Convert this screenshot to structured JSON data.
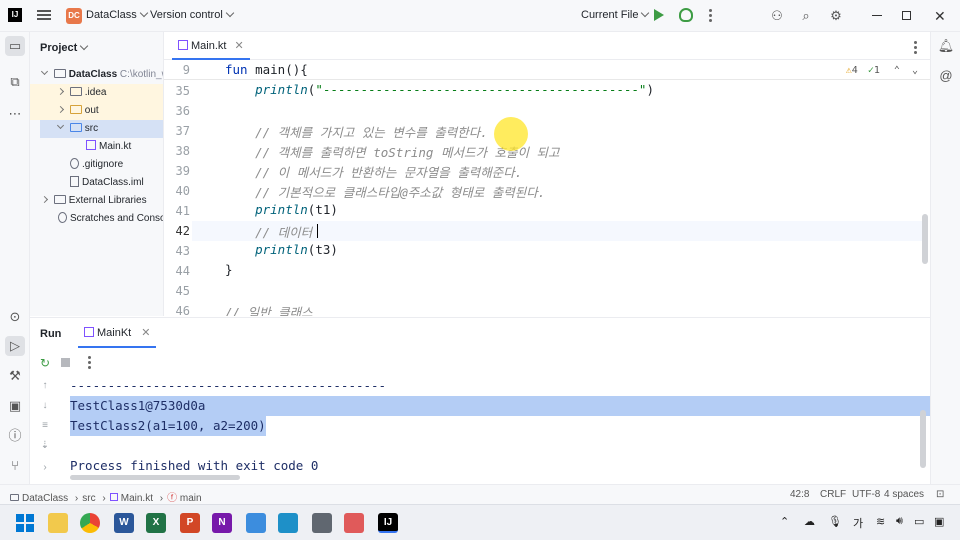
{
  "titlebar": {
    "logo_text": "IJ",
    "project_badge": "DC",
    "project_name": "DataClass",
    "version_control": "Version control",
    "current_file": "Current File"
  },
  "project_panel": {
    "header": "Project",
    "root_name": "DataClass",
    "root_path": "C:\\kotlin_w",
    "items": [
      {
        "label": ".idea"
      },
      {
        "label": "out"
      },
      {
        "label": "src"
      },
      {
        "label": "Main.kt"
      },
      {
        "label": ".gitignore"
      },
      {
        "label": "DataClass.iml"
      },
      {
        "label": "External Libraries"
      },
      {
        "label": "Scratches and Consoles"
      }
    ]
  },
  "editor": {
    "tab_label": "Main.kt",
    "inspections": {
      "warnings": "4",
      "ok": "1"
    },
    "sticky": {
      "num": "9",
      "code": "fun main(){"
    },
    "lines": [
      {
        "num": "35",
        "code": "    println(\"------------------------------------------\")"
      },
      {
        "num": "36",
        "code": ""
      },
      {
        "num": "37",
        "code": "    // 객체를 가지고 있는 변수를 출력한다."
      },
      {
        "num": "38",
        "code": "    // 객체를 출력하면 toString 메서드가 호출이 되고"
      },
      {
        "num": "39",
        "code": "    // 이 메서드가 반환하는 문자열을 출력해준다."
      },
      {
        "num": "40",
        "code": "    // 기본적으로 클래스타입@주소값 형태로 출력된다."
      },
      {
        "num": "41",
        "code": "    println(t1)"
      },
      {
        "num": "42",
        "code": "    // 데이터"
      },
      {
        "num": "43",
        "code": "    println(t3)"
      },
      {
        "num": "44",
        "code": "}"
      },
      {
        "num": "45",
        "code": ""
      },
      {
        "num": "46",
        "code": "// 일반 클래스"
      }
    ]
  },
  "run_panel": {
    "title": "Run",
    "tab_label": "MainKt",
    "console": [
      "------------------------------------------",
      "TestClass1@7530d0a",
      "TestClass2(a1=100, a2=200)",
      "",
      "Process finished with exit code 0"
    ]
  },
  "statusbar": {
    "crumbs": [
      "DataClass",
      "src",
      "Main.kt",
      "main"
    ],
    "position": "42:8",
    "line_sep": "CRLF",
    "encoding": "UTF-8",
    "indent": "4 spaces"
  },
  "taskbar": {
    "ime": "가"
  }
}
